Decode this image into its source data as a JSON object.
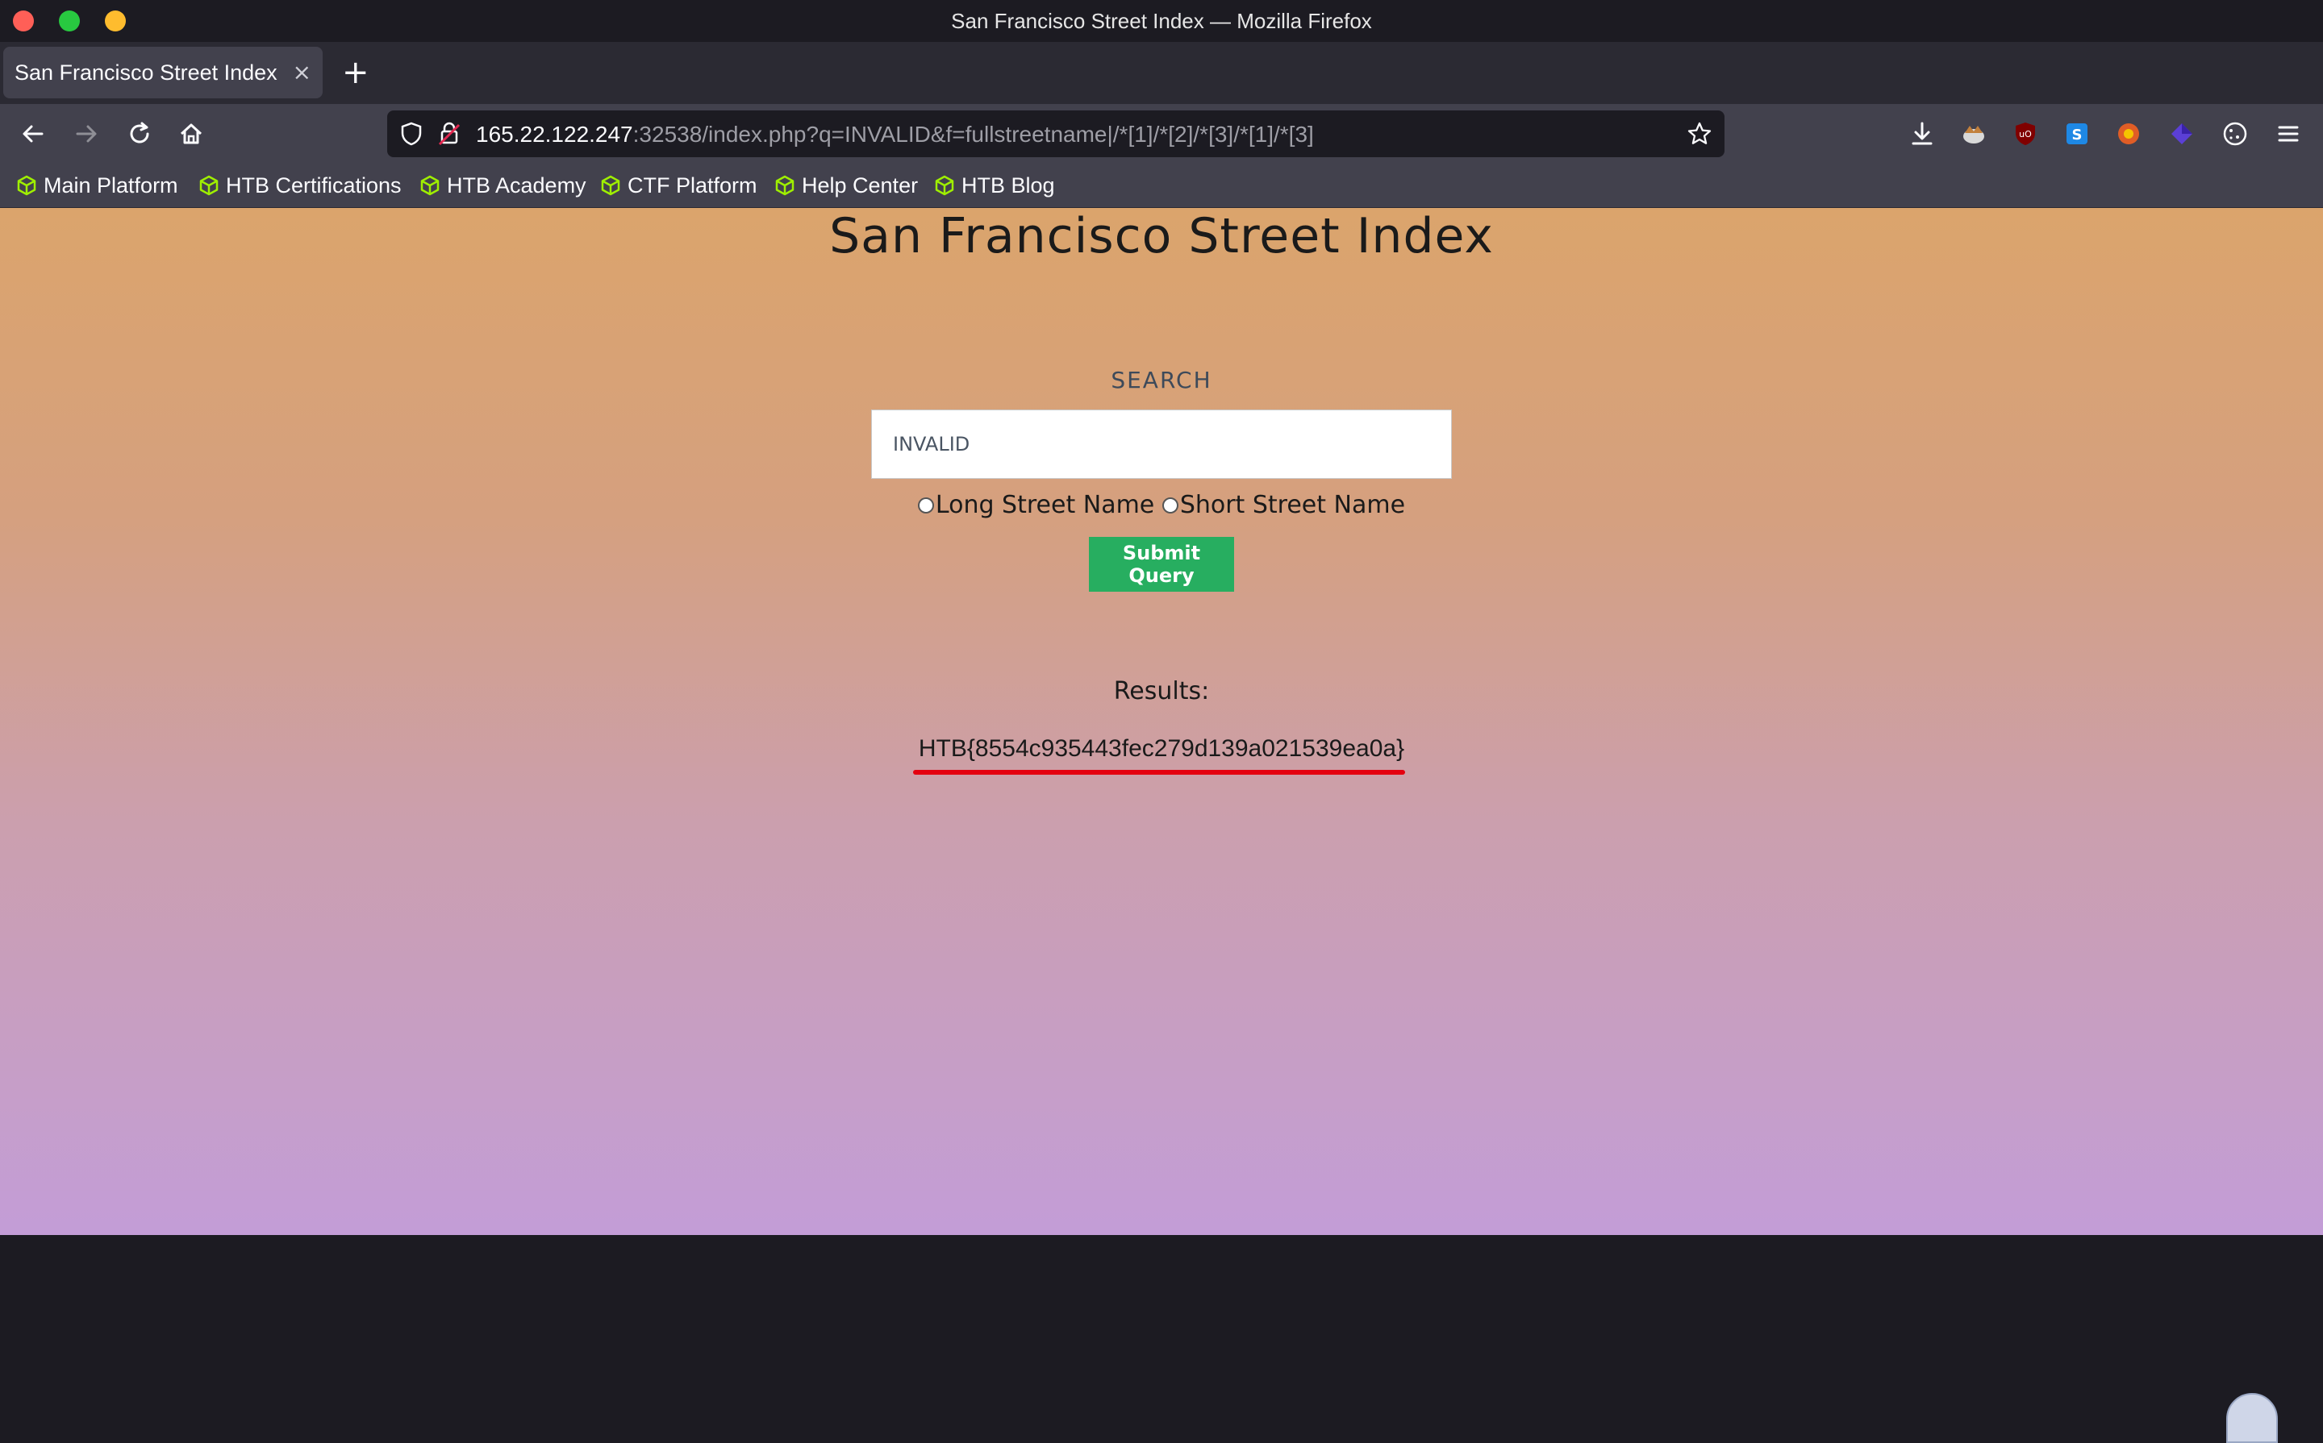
{
  "window": {
    "title": "San Francisco Street Index — Mozilla Firefox"
  },
  "tabs": [
    {
      "label": "San Francisco Street Index",
      "close_glyph": "×"
    }
  ],
  "new_tab_glyph": "+",
  "urlbar": {
    "host": "165.22.122.247",
    "rest": ":32538/index.php?q=INVALID&f=fullstreetname|/*[1]/*[2]/*[3]/*[1]/*[3]"
  },
  "bookmarks": [
    {
      "label": "Main Platform",
      "icon": "htb-cube-icon"
    },
    {
      "label": "HTB Certifications",
      "icon": "htb-cube-icon"
    },
    {
      "label": "HTB Academy",
      "icon": "htb-cube-icon"
    },
    {
      "label": "CTF Platform",
      "icon": "htb-cube-icon"
    },
    {
      "label": "Help Center",
      "icon": "htb-cube-icon"
    },
    {
      "label": "HTB Blog",
      "icon": "htb-cube-icon"
    }
  ],
  "page": {
    "title": "San Francisco Street Index",
    "search_label": "SEARCH",
    "search_value": "INVALID",
    "radio_long": "Long Street Name",
    "radio_short": "Short Street Name",
    "submit_label": "Submit Query",
    "results_label": "Results:",
    "result_value": "HTB{8554c935443fec279d139a021539ea0a}"
  },
  "colors": {
    "accent_green": "#27ae60",
    "highlight_red": "#e4000f",
    "htb_green": "#9fef00"
  }
}
